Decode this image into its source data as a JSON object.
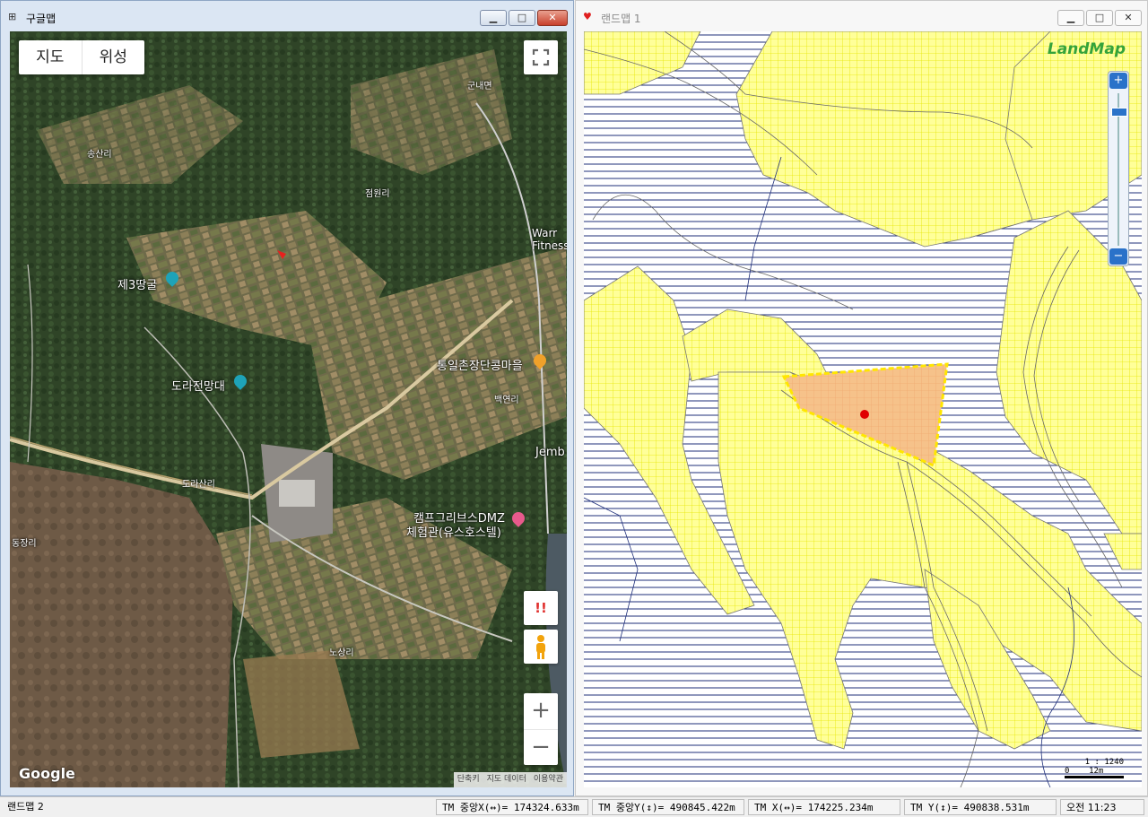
{
  "left_window": {
    "title": "구글맵",
    "map_type_buttons": [
      "지도",
      "위성"
    ],
    "report_glyph": "!!",
    "zoom_in": "+",
    "zoom_out": "−",
    "logo": "Google",
    "attribution": [
      "단축키",
      "지도 데이터",
      "이용약관"
    ],
    "labels": {
      "gunnae": "군내면",
      "songsan": "송산리",
      "jeomwon": "점원리",
      "warrior": "Warr\nFitness",
      "tunnel": "제3땅굴",
      "observatory": "도라전망대",
      "tongil": "통일촌장단콩마을",
      "baekyeon": "백연리",
      "jemb": "Jemb",
      "dorasan": "도라산리",
      "camp": "캠프그리브스DMZ",
      "camp2": "체험관(유스호스텔)",
      "dongjang": "동장리",
      "nosang": "노상리"
    }
  },
  "right_window": {
    "title": "랜드맵 1",
    "logo": "LandMap",
    "scale_ratio": "1 : 1240",
    "scale_bar": "0    12m"
  },
  "status_bar": {
    "app": "랜드맵 2",
    "tm_center_x": "TM 중앙X(↔)= 174324.633m",
    "tm_center_y": "TM 중앙Y(↕)= 490845.422m",
    "tm_x": "TM X(↔)= 174225.234m",
    "tm_y": "TM Y(↕)= 490838.531m",
    "clock": "오전 11:23"
  },
  "colors": {
    "parcel_yellow": "#ffff99",
    "parcel_grid": "#e6e600",
    "forest_lines": "#1f2f7a",
    "selected_parcel": "#f6c28a",
    "selected_outline": "#ffe600",
    "marker": "#e00000"
  }
}
